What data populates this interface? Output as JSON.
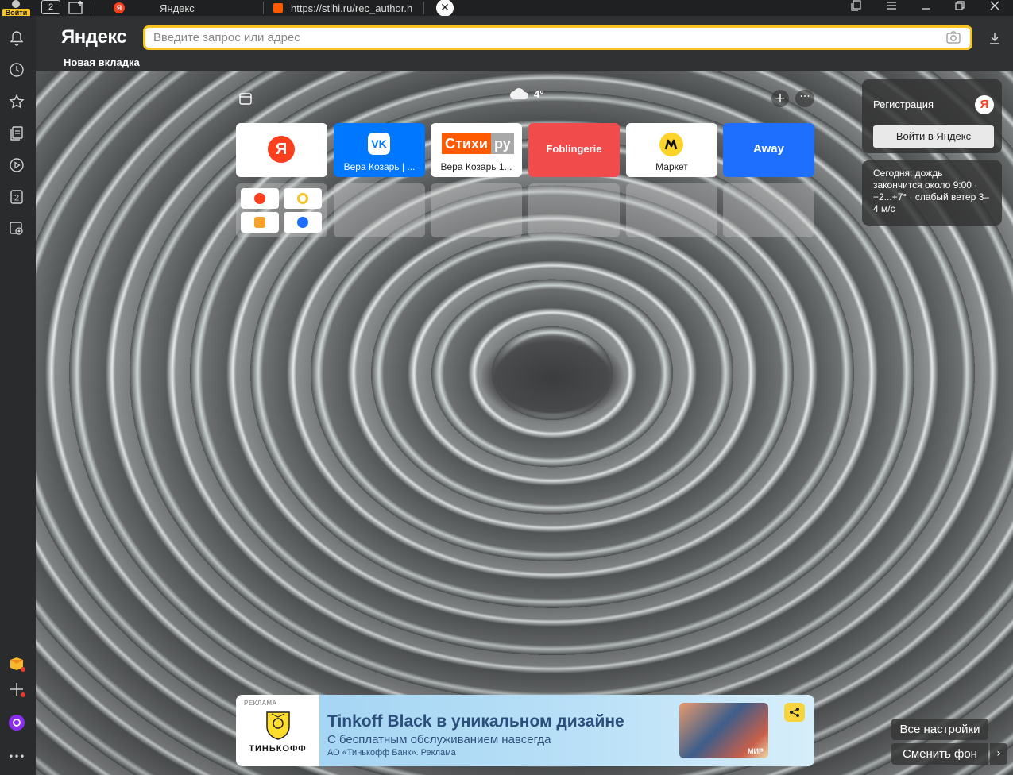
{
  "tabbar": {
    "login_label": "Войти",
    "tab_count": "2",
    "tabs": [
      {
        "title": "Яндекс"
      },
      {
        "title": "https://stihi.ru/rec_author.h"
      }
    ],
    "close_glyph": "✕"
  },
  "toolbar": {
    "logo": "Яндекс",
    "search_placeholder": "Введите запрос или адрес",
    "current_tab_label": "Новая вкладка"
  },
  "sidebar": {
    "items": [
      {
        "icon": "bell-icon"
      },
      {
        "icon": "history-icon"
      },
      {
        "icon": "bookmarks-star-icon"
      },
      {
        "icon": "collections-icon"
      },
      {
        "icon": "play-icon"
      },
      {
        "icon": "tab-counter-icon",
        "label": "2"
      },
      {
        "icon": "screenshot-camera-icon"
      }
    ],
    "bottom": [
      {
        "icon": "messenger-icon"
      },
      {
        "icon": "add-panel-icon"
      },
      {
        "icon": "alice-icon"
      },
      {
        "icon": "more-icon",
        "label": "•••"
      }
    ]
  },
  "newtab": {
    "weather_temp": "4°",
    "add_glyph": "+",
    "more_glyph": "···",
    "tiles": [
      {
        "id": "yandex",
        "caption": "",
        "logo": "Я",
        "bg": "#ffffff"
      },
      {
        "id": "vk",
        "caption": "Вера Козарь | ...",
        "logo": "VK",
        "bg": "#0077ff"
      },
      {
        "id": "stihi",
        "caption": "Вера Козарь 1...",
        "logo_a": "Стихи",
        "logo_b": "ру",
        "bg": "#ffffff"
      },
      {
        "id": "foblingerie",
        "caption": "Foblingerie",
        "bg": "#f24b4b"
      },
      {
        "id": "market",
        "caption": "Маркет",
        "bg": "#ffffff"
      },
      {
        "id": "away",
        "caption": "Away",
        "bg": "#1f6fff"
      }
    ],
    "registration": {
      "title": "Регистрация",
      "logo": "Я",
      "button": "Войти в Яндекс"
    },
    "weather_text": "Сегодня: дождь закончится около 9:00 · +2...+7° · слабый ветер 3–4 м/с",
    "ad": {
      "tag": "РЕКЛАМА",
      "brand": "ТИНЬКОФФ",
      "title": "Tinkoff Black в уникальном дизайне",
      "subtitle": "С бесплатным обслуживанием навсегда",
      "legal": "АО «Тинькофф Банк». Реклама",
      "card_mark": "МИР"
    },
    "settings_button": "Все настройки",
    "change_bg_button": "Сменить фон",
    "next_glyph": "›"
  },
  "colors": {
    "accent": "#f7c325",
    "yandex_red": "#fc3f1d",
    "vk_blue": "#0077ff"
  }
}
